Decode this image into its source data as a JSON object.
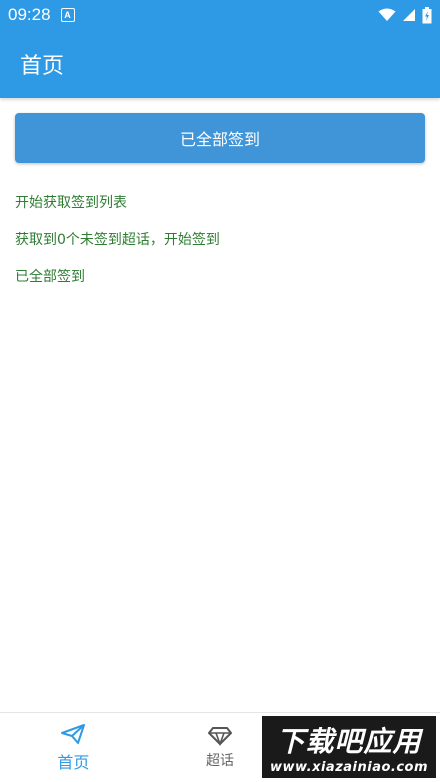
{
  "status_bar": {
    "time": "09:28",
    "a_indicator": "A",
    "icons": [
      "wifi-icon",
      "signal-icon",
      "battery-icon"
    ]
  },
  "app_bar": {
    "title": "首页"
  },
  "main": {
    "signin_button_label": "已全部签到",
    "log": [
      "开始获取签到列表",
      "获取到0个未签到超话，开始签到",
      "已全部签到"
    ]
  },
  "bottom_nav": {
    "items": [
      {
        "label": "首页",
        "icon": "paper-plane-icon",
        "active": true
      },
      {
        "label": "超话",
        "icon": "diamond-icon",
        "active": false
      },
      {
        "label": "",
        "icon": "settings-icon",
        "active": false
      }
    ]
  },
  "watermark": {
    "main": "下载吧应用",
    "url": "www.xiazainiao.com"
  },
  "colors": {
    "primary": "#2e9ae6",
    "button": "#3f95d8",
    "log_text": "#2e7d32"
  }
}
